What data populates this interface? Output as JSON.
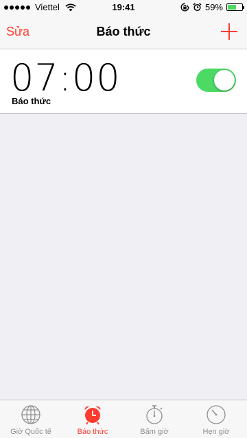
{
  "status_bar": {
    "carrier": "Viettel",
    "time": "19:41",
    "battery_percent_text": "59%",
    "battery_level": 0.59,
    "signal_dots": 5
  },
  "nav": {
    "edit_label": "Sửa",
    "title": "Báo thức"
  },
  "alarms": [
    {
      "time": "07:00",
      "label": "Báo thức",
      "enabled": true
    }
  ],
  "tabs": [
    {
      "label": "Giờ Quốc tế",
      "icon": "globe-icon",
      "active": false
    },
    {
      "label": "Báo thức",
      "icon": "alarm-clock-icon",
      "active": true
    },
    {
      "label": "Bấm giờ",
      "icon": "stopwatch-icon",
      "active": false
    },
    {
      "label": "Hẹn giờ",
      "icon": "timer-icon",
      "active": false
    }
  ],
  "colors": {
    "accent": "#ff3b30",
    "toggle_on": "#4cd964",
    "inactive_tab": "#8e8e93"
  }
}
